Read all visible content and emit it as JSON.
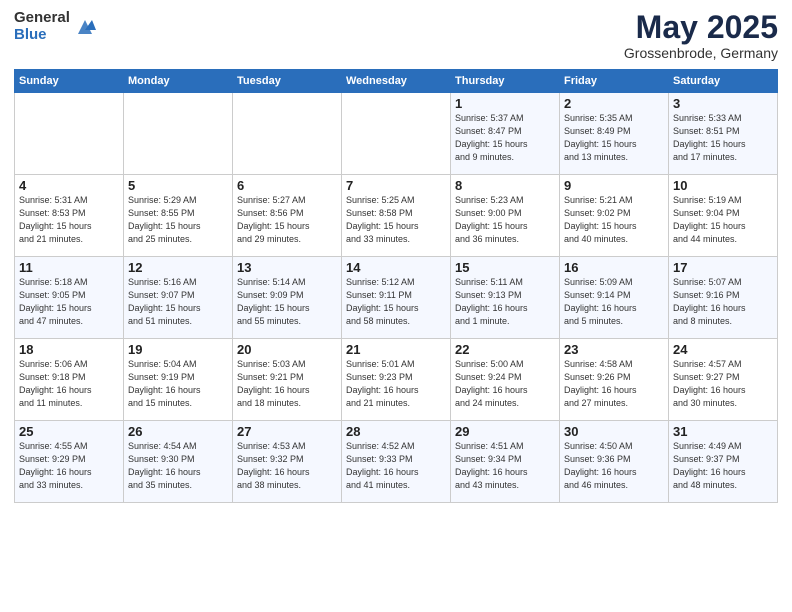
{
  "header": {
    "logo_general": "General",
    "logo_blue": "Blue",
    "title": "May 2025",
    "subtitle": "Grossenbrode, Germany"
  },
  "weekdays": [
    "Sunday",
    "Monday",
    "Tuesday",
    "Wednesday",
    "Thursday",
    "Friday",
    "Saturday"
  ],
  "weeks": [
    [
      {
        "num": "",
        "info": ""
      },
      {
        "num": "",
        "info": ""
      },
      {
        "num": "",
        "info": ""
      },
      {
        "num": "",
        "info": ""
      },
      {
        "num": "1",
        "info": "Sunrise: 5:37 AM\nSunset: 8:47 PM\nDaylight: 15 hours\nand 9 minutes."
      },
      {
        "num": "2",
        "info": "Sunrise: 5:35 AM\nSunset: 8:49 PM\nDaylight: 15 hours\nand 13 minutes."
      },
      {
        "num": "3",
        "info": "Sunrise: 5:33 AM\nSunset: 8:51 PM\nDaylight: 15 hours\nand 17 minutes."
      }
    ],
    [
      {
        "num": "4",
        "info": "Sunrise: 5:31 AM\nSunset: 8:53 PM\nDaylight: 15 hours\nand 21 minutes."
      },
      {
        "num": "5",
        "info": "Sunrise: 5:29 AM\nSunset: 8:55 PM\nDaylight: 15 hours\nand 25 minutes."
      },
      {
        "num": "6",
        "info": "Sunrise: 5:27 AM\nSunset: 8:56 PM\nDaylight: 15 hours\nand 29 minutes."
      },
      {
        "num": "7",
        "info": "Sunrise: 5:25 AM\nSunset: 8:58 PM\nDaylight: 15 hours\nand 33 minutes."
      },
      {
        "num": "8",
        "info": "Sunrise: 5:23 AM\nSunset: 9:00 PM\nDaylight: 15 hours\nand 36 minutes."
      },
      {
        "num": "9",
        "info": "Sunrise: 5:21 AM\nSunset: 9:02 PM\nDaylight: 15 hours\nand 40 minutes."
      },
      {
        "num": "10",
        "info": "Sunrise: 5:19 AM\nSunset: 9:04 PM\nDaylight: 15 hours\nand 44 minutes."
      }
    ],
    [
      {
        "num": "11",
        "info": "Sunrise: 5:18 AM\nSunset: 9:05 PM\nDaylight: 15 hours\nand 47 minutes."
      },
      {
        "num": "12",
        "info": "Sunrise: 5:16 AM\nSunset: 9:07 PM\nDaylight: 15 hours\nand 51 minutes."
      },
      {
        "num": "13",
        "info": "Sunrise: 5:14 AM\nSunset: 9:09 PM\nDaylight: 15 hours\nand 55 minutes."
      },
      {
        "num": "14",
        "info": "Sunrise: 5:12 AM\nSunset: 9:11 PM\nDaylight: 15 hours\nand 58 minutes."
      },
      {
        "num": "15",
        "info": "Sunrise: 5:11 AM\nSunset: 9:13 PM\nDaylight: 16 hours\nand 1 minute."
      },
      {
        "num": "16",
        "info": "Sunrise: 5:09 AM\nSunset: 9:14 PM\nDaylight: 16 hours\nand 5 minutes."
      },
      {
        "num": "17",
        "info": "Sunrise: 5:07 AM\nSunset: 9:16 PM\nDaylight: 16 hours\nand 8 minutes."
      }
    ],
    [
      {
        "num": "18",
        "info": "Sunrise: 5:06 AM\nSunset: 9:18 PM\nDaylight: 16 hours\nand 11 minutes."
      },
      {
        "num": "19",
        "info": "Sunrise: 5:04 AM\nSunset: 9:19 PM\nDaylight: 16 hours\nand 15 minutes."
      },
      {
        "num": "20",
        "info": "Sunrise: 5:03 AM\nSunset: 9:21 PM\nDaylight: 16 hours\nand 18 minutes."
      },
      {
        "num": "21",
        "info": "Sunrise: 5:01 AM\nSunset: 9:23 PM\nDaylight: 16 hours\nand 21 minutes."
      },
      {
        "num": "22",
        "info": "Sunrise: 5:00 AM\nSunset: 9:24 PM\nDaylight: 16 hours\nand 24 minutes."
      },
      {
        "num": "23",
        "info": "Sunrise: 4:58 AM\nSunset: 9:26 PM\nDaylight: 16 hours\nand 27 minutes."
      },
      {
        "num": "24",
        "info": "Sunrise: 4:57 AM\nSunset: 9:27 PM\nDaylight: 16 hours\nand 30 minutes."
      }
    ],
    [
      {
        "num": "25",
        "info": "Sunrise: 4:55 AM\nSunset: 9:29 PM\nDaylight: 16 hours\nand 33 minutes."
      },
      {
        "num": "26",
        "info": "Sunrise: 4:54 AM\nSunset: 9:30 PM\nDaylight: 16 hours\nand 35 minutes."
      },
      {
        "num": "27",
        "info": "Sunrise: 4:53 AM\nSunset: 9:32 PM\nDaylight: 16 hours\nand 38 minutes."
      },
      {
        "num": "28",
        "info": "Sunrise: 4:52 AM\nSunset: 9:33 PM\nDaylight: 16 hours\nand 41 minutes."
      },
      {
        "num": "29",
        "info": "Sunrise: 4:51 AM\nSunset: 9:34 PM\nDaylight: 16 hours\nand 43 minutes."
      },
      {
        "num": "30",
        "info": "Sunrise: 4:50 AM\nSunset: 9:36 PM\nDaylight: 16 hours\nand 46 minutes."
      },
      {
        "num": "31",
        "info": "Sunrise: 4:49 AM\nSunset: 9:37 PM\nDaylight: 16 hours\nand 48 minutes."
      }
    ]
  ]
}
